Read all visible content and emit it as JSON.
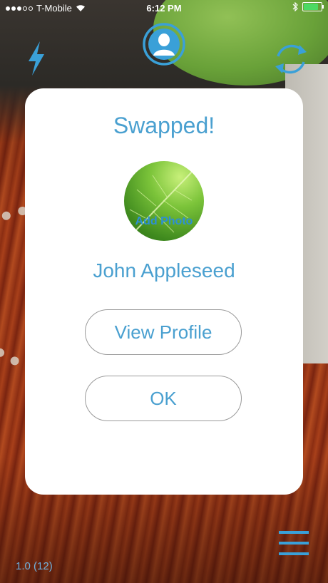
{
  "status_bar": {
    "carrier": "T-Mobile",
    "time": "6:12 PM",
    "signal_icon": "signal-dots-icon",
    "wifi_icon": "wifi-icon",
    "bluetooth_icon": "bluetooth-icon",
    "battery_icon": "battery-icon"
  },
  "toolbar": {
    "flash_icon": "lightning-bolt-icon",
    "profile_icon": "user-circle-icon",
    "swap_icon": "swap-arrows-icon"
  },
  "modal": {
    "title": "Swapped!",
    "avatar_caption": "Add Photo",
    "name": "John Appleseed",
    "view_profile_label": "View Profile",
    "ok_label": "OK"
  },
  "footer": {
    "version": "1.0 (12)",
    "menu_icon": "hamburger-menu-icon"
  },
  "colors": {
    "accent": "#4aa0d0",
    "battery": "#4cd964"
  }
}
